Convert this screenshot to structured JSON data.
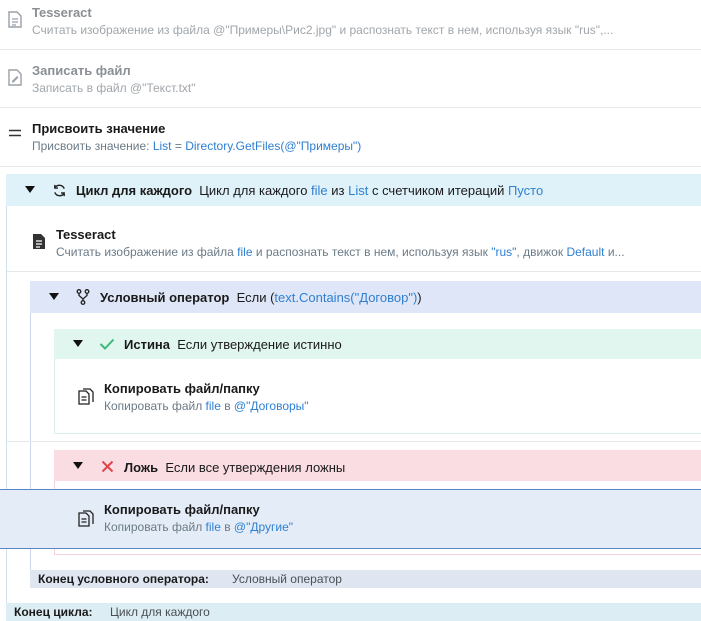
{
  "actions": {
    "tesseract1": {
      "title": "Tesseract",
      "desc_plain": "Считать изображение из файла @\"Примеры\\Рис2.jpg\" и распознать текст в нем, используя язык \"rus\",..."
    },
    "write_file": {
      "title": "Записать файл",
      "desc_plain": "Записать в файл @\"Текст.txt\""
    },
    "assign": {
      "title": "Присвоить значение",
      "desc_prefix": "Присвоить значение: ",
      "var": "List",
      "eq": " = ",
      "expr": "Directory.GetFiles(@\"Примеры\")"
    },
    "loop": {
      "title": "Цикл для каждого",
      "desc_1": "Цикл для каждого ",
      "var": "file",
      "desc_2": " из ",
      "list": "List",
      "desc_3": " с счетчиком итераций ",
      "counter": "Пусто"
    },
    "tesseract2": {
      "title": "Tesseract",
      "desc_1": "Считать изображение из файла ",
      "file": "file",
      "desc_2": " и распознать текст в нем, используя язык ",
      "lang": "\"rus\"",
      "desc_3": ", движок ",
      "engine": "Default",
      "desc_4": " и..."
    },
    "cond": {
      "title": "Условный оператор",
      "desc_1": "Если (",
      "expr": "text.Contains(\"Договор\")",
      "desc_2": ")"
    },
    "true_branch": {
      "title": "Истина",
      "desc": "Если утверждение истинно"
    },
    "copy1": {
      "title": "Копировать файл/папку",
      "desc_1": "Копировать файл ",
      "file": "file",
      "desc_2": " в ",
      "dest": "@\"Договоры\""
    },
    "false_branch": {
      "title": "Ложь",
      "desc": "Если все утверждения ложны"
    },
    "copy2": {
      "title": "Копировать файл/папку",
      "desc_1": "Копировать файл ",
      "file": "file",
      "desc_2": " в ",
      "dest": "@\"Другие\""
    },
    "end_cond": {
      "label": "Конец условного оператора:",
      "value": "Условный оператор"
    },
    "end_loop": {
      "label": "Конец цикла:",
      "value": "Цикл для каждого"
    }
  },
  "colors": {
    "highlight": "#2f80d1",
    "loop_header": "#dff1f9",
    "cond_header": "#dfe6f7",
    "true_header": "#e0f6ee",
    "false_header": "#fadde3",
    "selected_row": "#e4ecf7"
  },
  "icons": {
    "tesseract": "document-scan-icon",
    "write": "document-edit-icon",
    "assign": "equals-icon",
    "loop": "refresh-icon",
    "cond": "branch-icon",
    "true": "check-icon",
    "false": "cross-icon",
    "copy": "copy-files-icon"
  }
}
